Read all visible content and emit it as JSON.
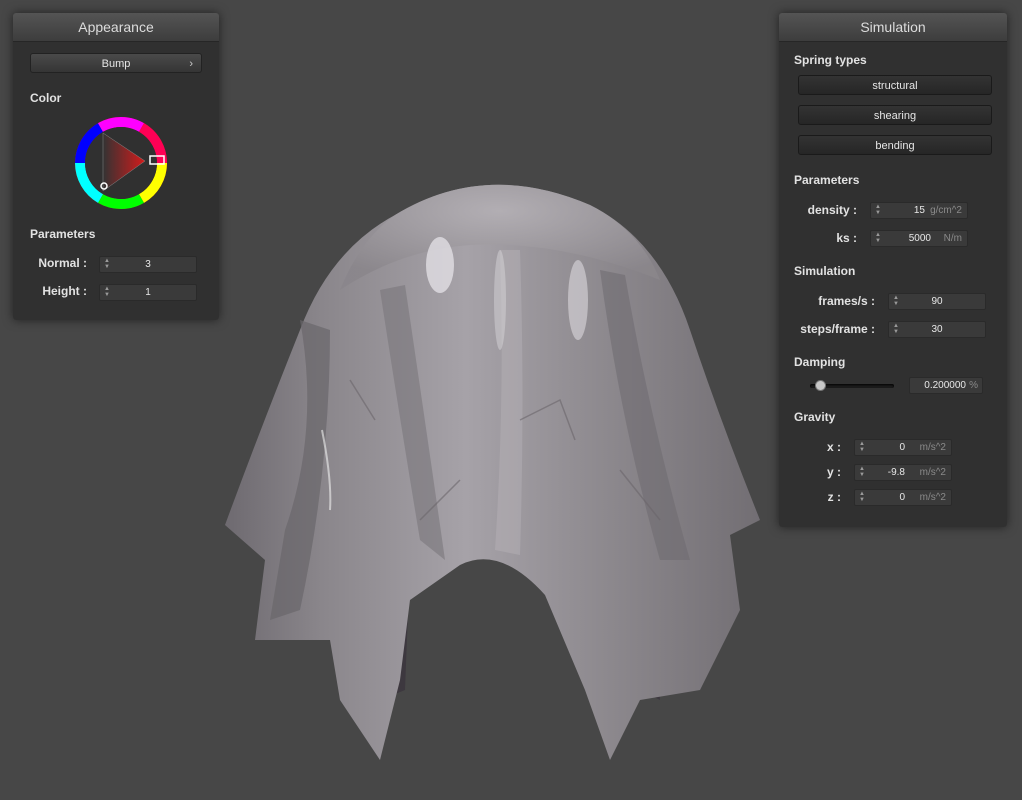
{
  "appearance": {
    "title": "Appearance",
    "shader_button": "Bump",
    "color_label": "Color",
    "color": "#8e1616",
    "parameters_label": "Parameters",
    "normal": {
      "label": "Normal :",
      "value": "3"
    },
    "height": {
      "label": "Height :",
      "value": "1"
    }
  },
  "simulation": {
    "title": "Simulation",
    "spring_types_label": "Spring types",
    "springs": [
      "structural",
      "shearing",
      "bending"
    ],
    "parameters_label": "Parameters",
    "density": {
      "label": "density :",
      "value": "15",
      "unit": "g/cm^2"
    },
    "ks": {
      "label": "ks :",
      "value": "5000",
      "unit": "N/m"
    },
    "simulation_label": "Simulation",
    "frames": {
      "label": "frames/s :",
      "value": "90"
    },
    "steps": {
      "label": "steps/frame :",
      "value": "30"
    },
    "damping_label": "Damping",
    "damping": {
      "value": "0.200000",
      "unit": "%",
      "slider_level": 0.2
    },
    "gravity_label": "Gravity",
    "gravity": [
      {
        "label": "x :",
        "value": "0",
        "unit": "m/s^2"
      },
      {
        "label": "y :",
        "value": "-9.8",
        "unit": "m/s^2"
      },
      {
        "label": "z :",
        "value": "0",
        "unit": "m/s^2"
      }
    ]
  },
  "status": {
    "text": ""
  }
}
